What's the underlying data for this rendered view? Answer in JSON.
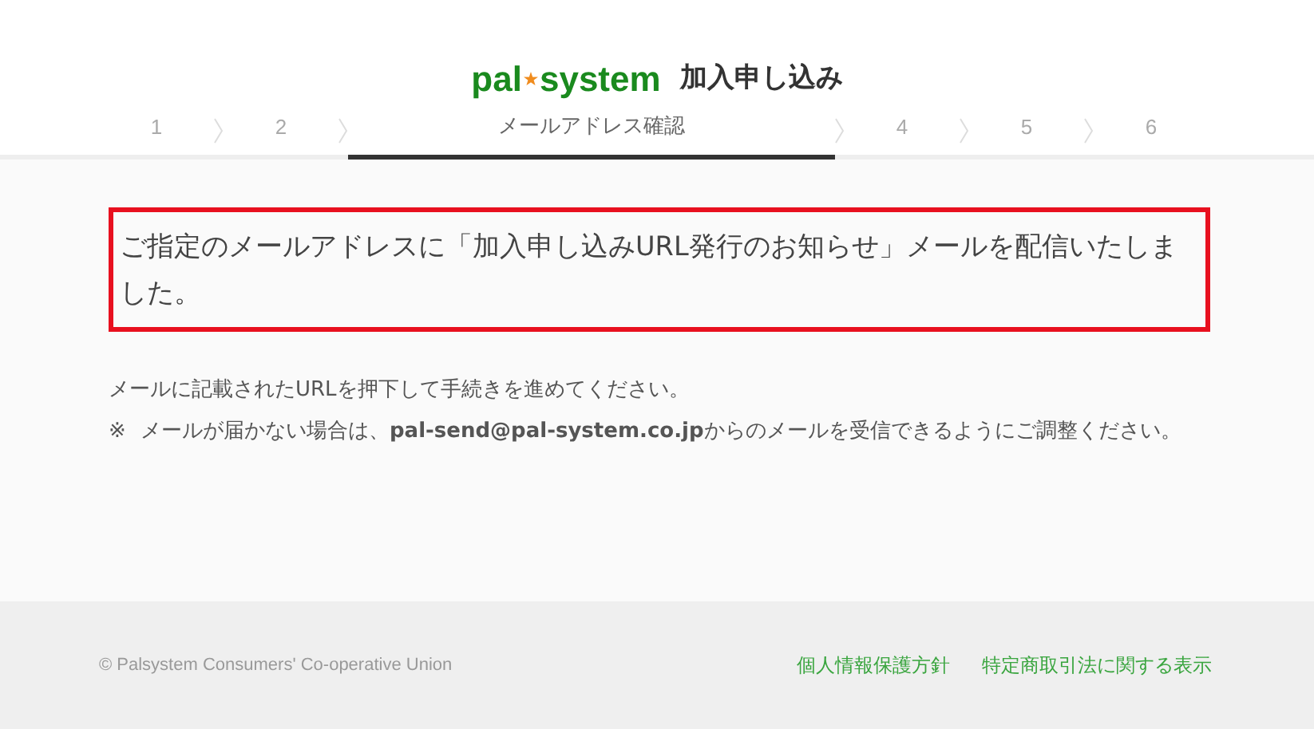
{
  "header": {
    "logo": {
      "part_1": "pal",
      "part_2": "system"
    },
    "title": "加入申し込み"
  },
  "steps": [
    {
      "label": "1",
      "selected": false
    },
    {
      "label": "2",
      "selected": false
    },
    {
      "label": "メールアドレス確認",
      "selected": true
    },
    {
      "label": "4",
      "selected": false
    },
    {
      "label": "5",
      "selected": false
    },
    {
      "label": "6",
      "selected": false
    }
  ],
  "notice": "ご指定のメールアドレスに「加入申し込みURL発行のお知らせ」メールを配信いたしました。",
  "instructions": [
    {
      "text": "メールに記載されたURLを押下して手続きを進めてください。"
    },
    {
      "mark": "※",
      "text": "メールが届かない場合は、**pal-send@pal-system.co.jp**からのメールを受信できるようにご調整ください。"
    }
  ],
  "footer": {
    "copyright": "© Palsystem Consumers' Co-operative Union",
    "links": [
      "個人情報保護方針",
      "特定商取引法に関する表示"
    ]
  }
}
